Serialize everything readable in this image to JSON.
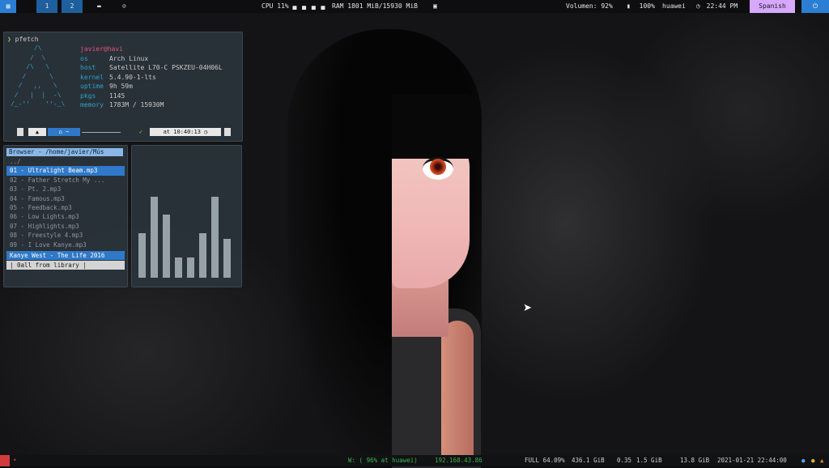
{
  "topbar": {
    "apps_icon": "grid-icon",
    "workspaces": [
      "1",
      "2"
    ],
    "folder_icon": "folder-icon",
    "compass_icon": "compass-icon",
    "cpu": "CPU 11%",
    "ram": "RAM 1801 MiB/15930 MiB",
    "volume": "Volumen: 92%",
    "battery": "100%",
    "wifi": "huawei",
    "time": "22:44 PM",
    "language": "Spanish",
    "power_icon": "power-icon",
    "accent": "#2a7fd4",
    "lang_color": "#d6a8ff"
  },
  "pfetch": {
    "prompt": "pfetch",
    "logo": "      /\\\n     /  \\\n    /\\   \\\n   /      \\\n  /   ,,   \\\n /   |  |  -\\\n/_-''    ''-_\\",
    "user": "javier@havi",
    "rows": [
      {
        "key": "os",
        "val": "Arch Linux"
      },
      {
        "key": "host",
        "val": "Satellite L70-C PSKZEU-04H06L"
      },
      {
        "key": "kernel",
        "val": "5.4.90-1-lts"
      },
      {
        "key": "uptime",
        "val": "9h 59m"
      },
      {
        "key": "pkgs",
        "val": "1145"
      },
      {
        "key": "memory",
        "val": "1783M / 15930M"
      }
    ],
    "status_dir": "~",
    "status_check": "✓",
    "status_time": "at 10:40:13"
  },
  "music": {
    "header": "Browser - /home/javier/Mús",
    "parent": "../",
    "tracks": [
      "01 - Ultralight Beam.mp3",
      "02 - Father Stretch My ...",
      "03 - Pt. 2.mp3",
      "04 - Famous.mp3",
      "05 - Feedback.mp3",
      "06 - Low Lights.mp3",
      "07 - Highlights.mp3",
      "08 - Freestyle 4.mp3",
      "09 - I Love Kanye.mp3"
    ],
    "now_playing": "Kanye West - The Life 2016",
    "command": "| 0all from library |"
  },
  "visualizer": {
    "levels": [
      0.55,
      1.0,
      0.78,
      0.25,
      0.25,
      0.55,
      1.0,
      0.48
    ]
  },
  "bottombar": {
    "seg_wifi": "W: ( 96% at huawei)",
    "seg_ip": "192.168.43.86",
    "seg_bat": "FULL 64.09%",
    "seg_disk": "436.1 GiB",
    "seg_load": "0.35",
    "seg_mem": "1.5 GiB",
    "seg_mem2": "13.8 GiB",
    "seg_date": "2021-01-21 22:44:00"
  }
}
